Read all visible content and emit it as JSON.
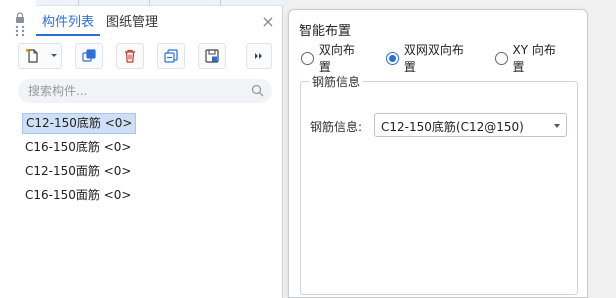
{
  "panel": {
    "tabs": [
      {
        "label": "构件列表",
        "active": true
      },
      {
        "label": "图纸管理",
        "active": false
      }
    ],
    "close_symbol": "×",
    "toolbar": {
      "icons": [
        "new-component-icon",
        "dropdown-arrow-icon",
        "copy-icon",
        "delete-icon",
        "copy-to-floor-icon",
        "save-icon",
        "more-icon"
      ]
    },
    "search": {
      "placeholder": "搜索构件...",
      "value": ""
    },
    "items": [
      {
        "name": "C12-150底筋",
        "count": "<0>",
        "selected": true
      },
      {
        "name": "C16-150底筋",
        "count": "<0>",
        "selected": false
      },
      {
        "name": "C12-150面筋",
        "count": "<0>",
        "selected": false
      },
      {
        "name": "C16-150面筋",
        "count": "<0>",
        "selected": false
      }
    ]
  },
  "dialog": {
    "title": "智能布置",
    "radios": [
      {
        "label": "双向布置",
        "checked": false
      },
      {
        "label": "双网双向布置",
        "checked": true
      },
      {
        "label": "XY 向布置",
        "checked": false
      }
    ],
    "group_title": "钢筋信息",
    "field_label": "钢筋信息:",
    "select_value": "C12-150底筋(C12@150)"
  },
  "colors": {
    "accent": "#2b6fd6",
    "selection": "#cfe0f6"
  }
}
